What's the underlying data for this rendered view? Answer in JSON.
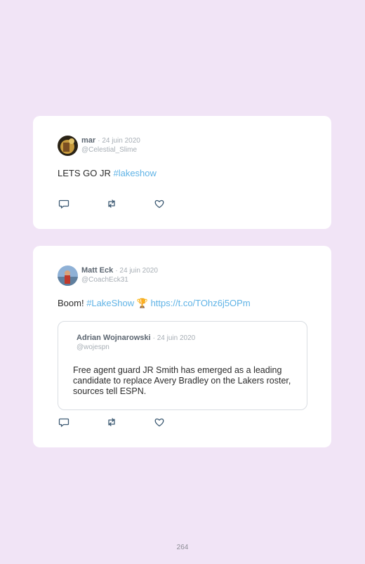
{
  "tweets": [
    {
      "author": "mar",
      "date": "· 24 juin 2020",
      "handle": "@Celestial_Slime",
      "text": "LETS GO JR ",
      "hashtag": "#lakeshow"
    },
    {
      "author": "Matt Eck",
      "date": "· 24 juin 2020",
      "handle": "@CoachEck31",
      "text": "Boom! ",
      "hashtag": "#LakeShow",
      "emoji": "🏆",
      "link": "https://t.co/TOhz6j5OPm",
      "quote": {
        "author": "Adrian Wojnarowski",
        "date": "· 24 juin 2020",
        "handle": "@wojespn",
        "text": "Free agent guard JR Smith has emerged as a leading candidate to replace Avery Bradley on the Lakers roster, sources tell ESPN."
      }
    }
  ],
  "actions": {
    "reply_icon": "reply-icon",
    "retweet_icon": "retweet-icon",
    "like_icon": "heart-icon"
  },
  "page_number": "264",
  "colors": {
    "background": "#f1e4f6",
    "link": "#5fb3e6",
    "icon": "#3d5a73"
  }
}
